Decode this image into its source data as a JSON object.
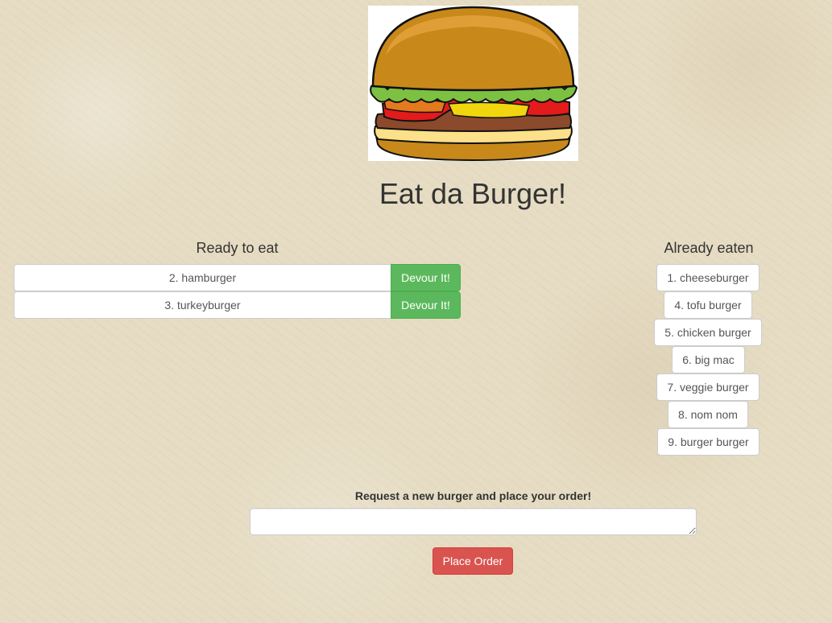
{
  "header": {
    "logo_icon": "burger-icon",
    "title": "Eat da Burger!"
  },
  "ready": {
    "heading": "Ready to eat",
    "items": [
      {
        "name": "2. hamburger",
        "button": "Devour It!"
      },
      {
        "name": "3. turkeyburger",
        "button": "Devour It!"
      }
    ]
  },
  "eaten": {
    "heading": "Already eaten",
    "items": [
      "1. cheeseburger",
      "4. tofu burger",
      "5. chicken burger",
      "6. big mac",
      "7. veggie burger",
      "8. nom nom",
      "9. burger burger"
    ]
  },
  "order_form": {
    "label": "Request a new burger and place your order!",
    "input_value": "",
    "submit_label": "Place Order"
  },
  "colors": {
    "devour_button": "#5cb85c",
    "place_order_button": "#d9534f",
    "background": "#e6dcc3"
  }
}
